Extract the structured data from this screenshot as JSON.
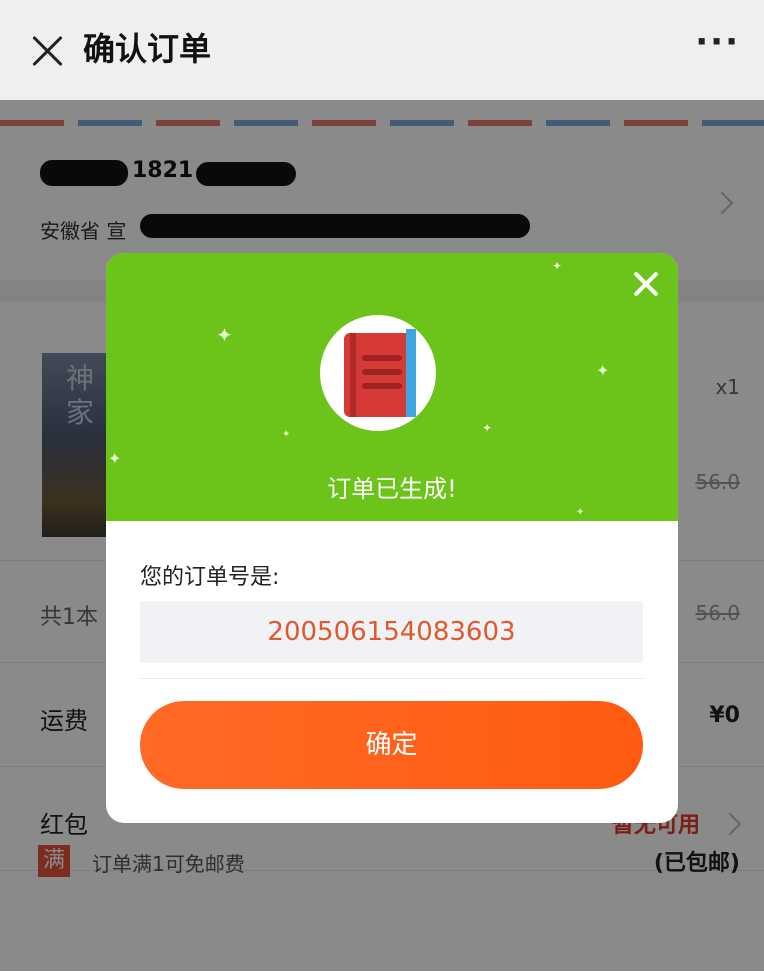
{
  "topbar": {
    "title": "确认订单",
    "more": "···"
  },
  "address": {
    "name_phone": "1821",
    "detail": "安徽省 宣"
  },
  "product": {
    "cover_text": "神\n家",
    "quantity": "x1",
    "price": "56.0"
  },
  "summary": {
    "count_text": "共1本",
    "total": "56.0"
  },
  "shipping": {
    "label": "运费",
    "value": "¥0"
  },
  "redpacket": {
    "label": "红包",
    "value": "暂无可用"
  },
  "free_shipping": {
    "badge": "满",
    "text": "订单满1可免邮费",
    "status": "(已包邮)"
  },
  "modal": {
    "title": "订单已生成!",
    "order_label": "您的订单号是:",
    "order_number": "200506154083603",
    "confirm_label": "确定"
  },
  "colors": {
    "header_green": "#6cc41a",
    "confirm_orange": "#ff6a26",
    "order_number": "#e1582a"
  }
}
